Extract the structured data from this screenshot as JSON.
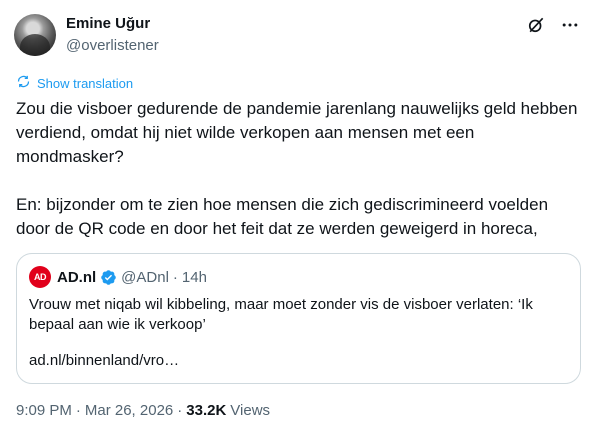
{
  "author": {
    "name": "Emine Uğur",
    "handle": "@overlistener"
  },
  "icons": {
    "grok": "grok-icon",
    "more": "more-icon",
    "translate": "translate-icon",
    "verified": "verified-badge-icon"
  },
  "translate_label": "Show translation",
  "tweet": {
    "paragraph1": "Zou die visboer gedurende de pandemie jarenlang nauwelijks geld hebben verdiend, omdat hij niet wilde verkopen aan mensen met een mondmasker?",
    "paragraph2": "En: bijzonder om te zien hoe mensen die zich gediscrimineerd voelden door de QR code en door het feit dat ze werden geweigerd in horeca,"
  },
  "quote": {
    "logo_text": "AD",
    "name": "AD.nl",
    "handle": "@ADnl",
    "separator": "·",
    "time": "14h",
    "text": "Vrouw met niqab wil kibbeling, maar moet zonder vis de visboer verlaten: ‘Ik bepaal aan wie ik verkoop’",
    "link": "ad.nl/binnenland/vro…"
  },
  "meta": {
    "time": "9:09 PM",
    "sep1": "·",
    "date": "Mar 26, 2026",
    "sep2": "·",
    "views_count": "33.2K",
    "views_label": "Views"
  },
  "colors": {
    "accent": "#1d9bf0",
    "text": "#0f1419",
    "secondary": "#536471",
    "border": "#cfd9de",
    "ad_red": "#e1001b"
  }
}
